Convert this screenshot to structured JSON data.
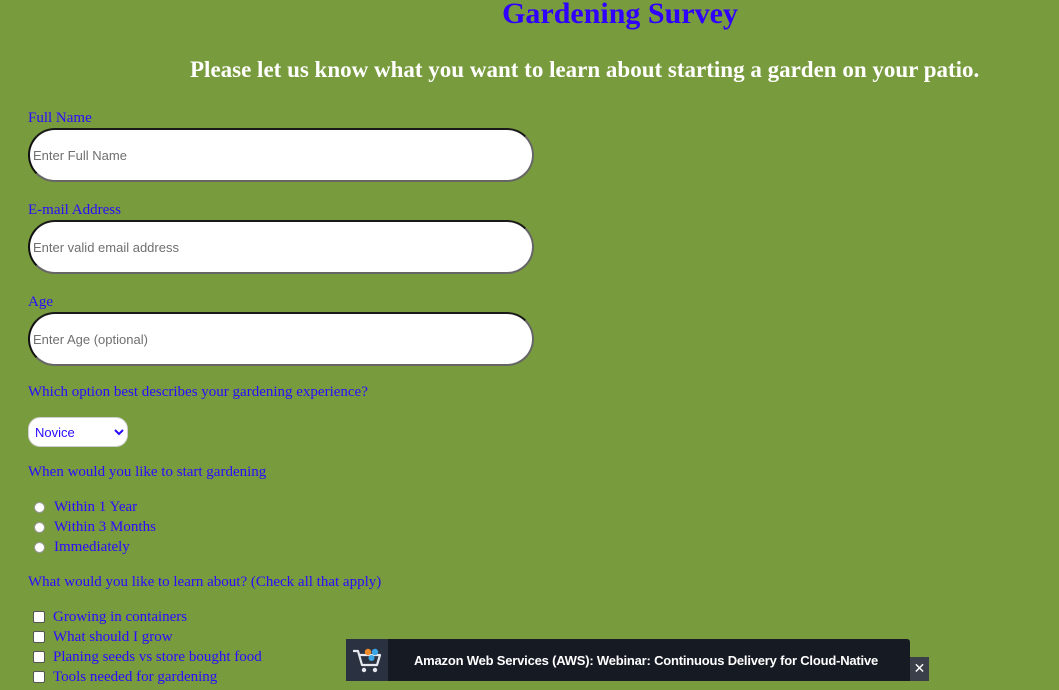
{
  "header": {
    "title": "Gardening Survey",
    "subtitle": "Please let us know what you want to learn about starting a garden on your patio."
  },
  "form": {
    "full_name": {
      "label": "Full Name",
      "placeholder": "Enter Full Name",
      "value": ""
    },
    "email": {
      "label": "E-mail Address",
      "placeholder": "Enter valid email address",
      "value": ""
    },
    "age": {
      "label": "Age",
      "placeholder": "Enter Age (optional)",
      "value": ""
    },
    "experience": {
      "label": "Which option best describes your gardening experience?",
      "selected": "Novice"
    },
    "start": {
      "label": "When would you like to start gardening",
      "options": [
        {
          "label": "Within 1 Year",
          "checked": false
        },
        {
          "label": "Within 3 Months",
          "checked": false
        },
        {
          "label": "Immediately",
          "checked": false
        }
      ]
    },
    "learn": {
      "label": "What would you like to learn about? (Check all that apply)",
      "options": [
        {
          "label": "Growing in containers",
          "checked": false
        },
        {
          "label": "What should I grow",
          "checked": false
        },
        {
          "label": "Planing seeds vs store bought food",
          "checked": false
        },
        {
          "label": "Tools needed for gardening",
          "checked": false
        }
      ]
    }
  },
  "ad_banner": {
    "text": "Amazon Web Services (AWS): Webinar: Continuous Delivery for Cloud-Native",
    "icon": "shopping-cart-icon",
    "close_icon": "close-icon",
    "close_glyph": "✕"
  },
  "colors": {
    "background": "#789b3d",
    "accent_text": "#2b0bff",
    "title": "#2f00ff",
    "subtitle": "#ffffff",
    "banner_bg": "#161a23"
  }
}
